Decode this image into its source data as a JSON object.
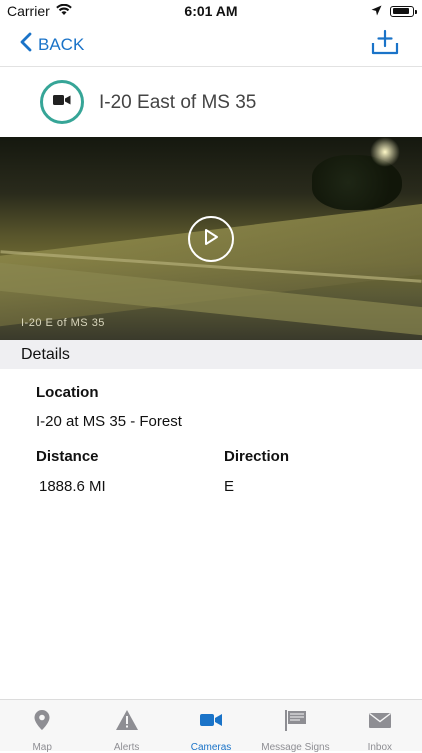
{
  "status_bar": {
    "carrier": "Carrier",
    "time": "6:01 AM",
    "battery_level": 0.9
  },
  "nav": {
    "back_label": "BACK",
    "accent_color": "#1a73c8"
  },
  "camera": {
    "title": "I-20 East of MS 35",
    "badge_color": "#36a597",
    "video_overlay_text": "I-20 E of MS 35"
  },
  "details": {
    "section_title": "Details",
    "location_label": "Location",
    "location_value": "I-20 at MS 35 - Forest",
    "distance_label": "Distance",
    "distance_value": "1888.6 MI",
    "direction_label": "Direction",
    "direction_value": "E"
  },
  "tabs": [
    {
      "label": "Map",
      "icon": "map-pin-icon",
      "active": false
    },
    {
      "label": "Alerts",
      "icon": "warning-icon",
      "active": false
    },
    {
      "label": "Cameras",
      "icon": "video-camera-icon",
      "active": true
    },
    {
      "label": "Message Signs",
      "icon": "sign-icon",
      "active": false
    },
    {
      "label": "Inbox",
      "icon": "mail-icon",
      "active": false
    }
  ]
}
